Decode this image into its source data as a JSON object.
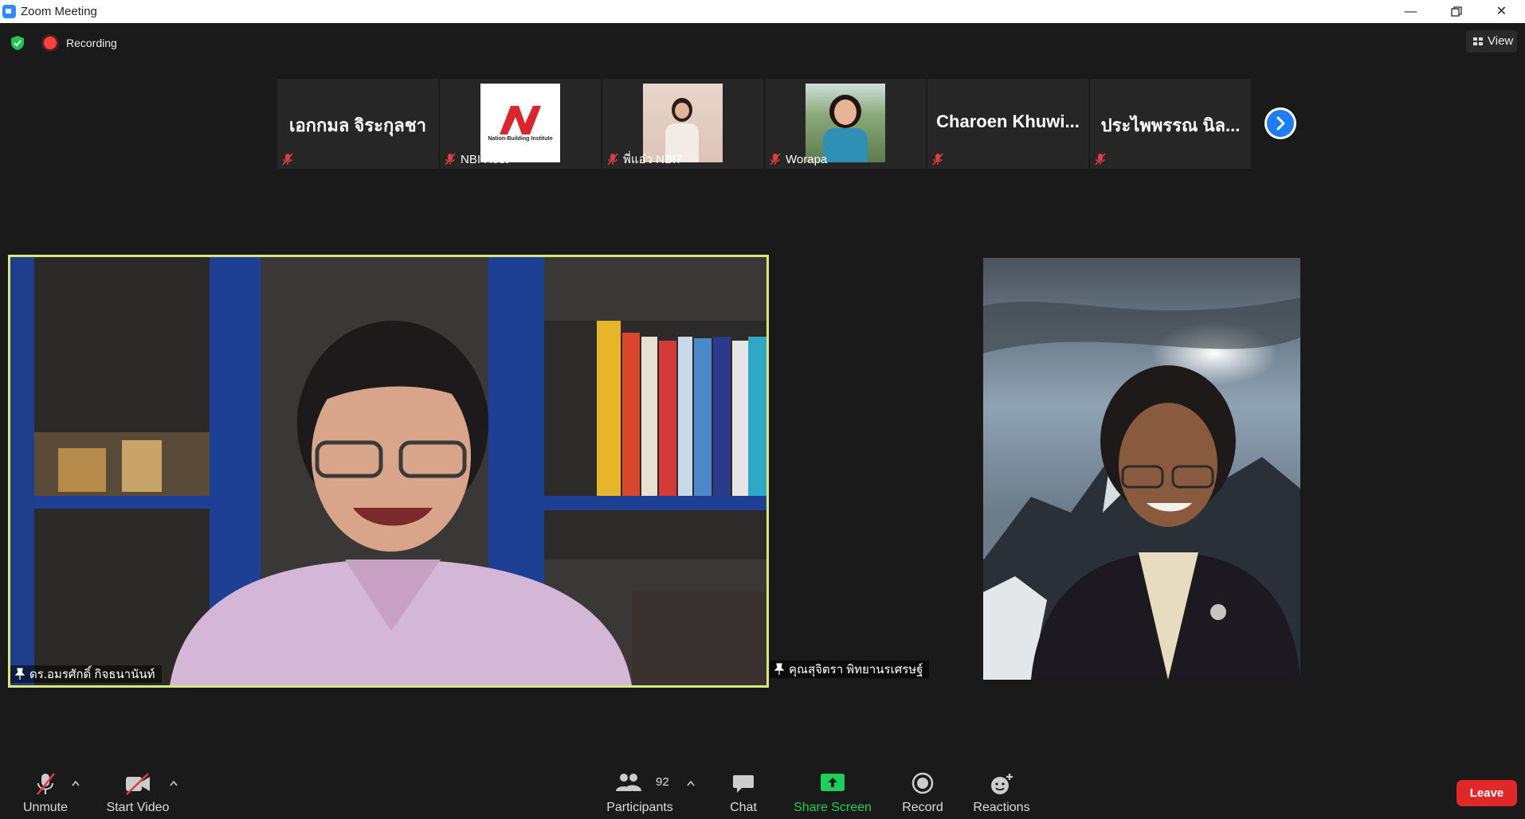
{
  "window": {
    "title": "Zoom Meeting"
  },
  "topbar": {
    "recording_label": "Recording",
    "view_label": "View"
  },
  "thumbnails": [
    {
      "big_name": "เอกกมล จิระกุลชา",
      "caption": ""
    },
    {
      "big_name": "",
      "caption": "NBI Host",
      "logo_text": "Nation-Building Institute"
    },
    {
      "big_name": "",
      "caption": "พี่แอ๋ว NBI7"
    },
    {
      "big_name": "",
      "caption": "Worapa"
    },
    {
      "big_name": "Charoen  Khuwi...",
      "caption": ""
    },
    {
      "big_name": "ประไพพรรณ นิล...",
      "caption": ""
    }
  ],
  "main": {
    "left_name": "ดร.อมรศักดิ์ กิจธนานันท์",
    "right_name": "คุณสุจิตรา พิทยานรเศรษฐ์"
  },
  "toolbar": {
    "unmute": "Unmute",
    "start_video": "Start Video",
    "participants": "Participants",
    "participants_count": "92",
    "chat": "Chat",
    "share_screen": "Share Screen",
    "record": "Record",
    "reactions": "Reactions",
    "leave": "Leave"
  },
  "colors": {
    "accent": "#1e7cf5",
    "active_speaker": "#d7e87a",
    "share": "#1fcf5c",
    "leave": "#e02828",
    "mute": "#e03c3c"
  }
}
